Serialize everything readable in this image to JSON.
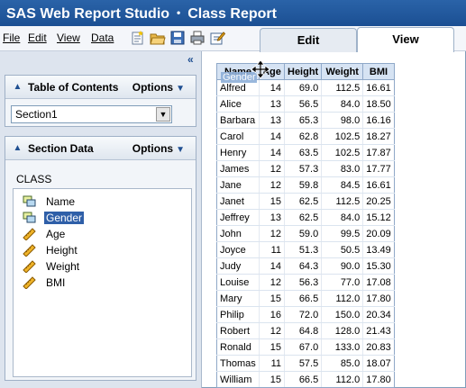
{
  "title": {
    "app": "SAS Web Report Studio",
    "separator": "•",
    "report": "Class Report"
  },
  "menu": {
    "file": "File",
    "edit": "Edit",
    "view": "View",
    "data": "Data"
  },
  "toolbar": {
    "icons": [
      "new-report-icon",
      "open-icon",
      "save-icon",
      "print-icon",
      "edit-report-icon"
    ]
  },
  "tabs": {
    "edit": "Edit",
    "view": "View"
  },
  "collapse": "«",
  "toc": {
    "title": "Table of Contents",
    "options": "Options",
    "selected_section": "Section1"
  },
  "section_data": {
    "title": "Section Data",
    "options": "Options",
    "source": "CLASS",
    "variables": [
      {
        "label": "Name",
        "type": "category",
        "selected": false
      },
      {
        "label": "Gender",
        "type": "category",
        "selected": true
      },
      {
        "label": "Age",
        "type": "measure",
        "selected": false
      },
      {
        "label": "Height",
        "type": "measure",
        "selected": false
      },
      {
        "label": "Weight",
        "type": "measure",
        "selected": false
      },
      {
        "label": "BMI",
        "type": "measure",
        "selected": false
      }
    ]
  },
  "report": {
    "columns": [
      "Name",
      "Age",
      "Height",
      "Weight",
      "BMI"
    ],
    "drag_label": "Gender",
    "rows": [
      [
        "Alfred",
        "14",
        "69.0",
        "112.5",
        "16.61"
      ],
      [
        "Alice",
        "13",
        "56.5",
        "84.0",
        "18.50"
      ],
      [
        "Barbara",
        "13",
        "65.3",
        "98.0",
        "16.16"
      ],
      [
        "Carol",
        "14",
        "62.8",
        "102.5",
        "18.27"
      ],
      [
        "Henry",
        "14",
        "63.5",
        "102.5",
        "17.87"
      ],
      [
        "James",
        "12",
        "57.3",
        "83.0",
        "17.77"
      ],
      [
        "Jane",
        "12",
        "59.8",
        "84.5",
        "16.61"
      ],
      [
        "Janet",
        "15",
        "62.5",
        "112.5",
        "20.25"
      ],
      [
        "Jeffrey",
        "13",
        "62.5",
        "84.0",
        "15.12"
      ],
      [
        "John",
        "12",
        "59.0",
        "99.5",
        "20.09"
      ],
      [
        "Joyce",
        "11",
        "51.3",
        "50.5",
        "13.49"
      ],
      [
        "Judy",
        "14",
        "64.3",
        "90.0",
        "15.30"
      ],
      [
        "Louise",
        "12",
        "56.3",
        "77.0",
        "17.08"
      ],
      [
        "Mary",
        "15",
        "66.5",
        "112.0",
        "17.80"
      ],
      [
        "Philip",
        "16",
        "72.0",
        "150.0",
        "20.34"
      ],
      [
        "Robert",
        "12",
        "64.8",
        "128.0",
        "21.43"
      ],
      [
        "Ronald",
        "15",
        "67.0",
        "133.0",
        "20.83"
      ],
      [
        "Thomas",
        "11",
        "57.5",
        "85.0",
        "18.07"
      ],
      [
        "William",
        "15",
        "66.5",
        "112.0",
        "17.80"
      ]
    ]
  }
}
